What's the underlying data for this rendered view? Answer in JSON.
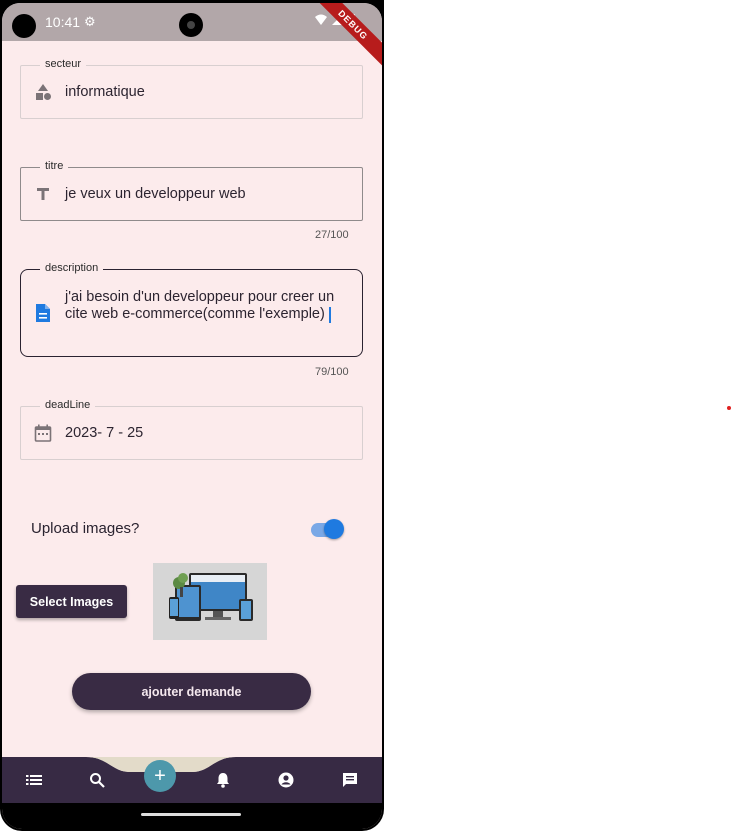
{
  "status_bar": {
    "time": "10:41",
    "debug_label": "DEBUG"
  },
  "form": {
    "secteur": {
      "label": "secteur",
      "value": "informatique",
      "icon": "category-icon"
    },
    "titre": {
      "label": "titre",
      "value": "je veux un developpeur web",
      "counter": "27/100",
      "icon": "title-icon"
    },
    "description": {
      "label": "description",
      "value_line1": "j'ai besoin d'un developpeur pour creer un",
      "value_line2": "cite web e-commerce(comme l'exemple)",
      "counter": "79/100",
      "icon": "document-icon"
    },
    "deadline": {
      "label": "deadLine",
      "value": "2023- 7 - 25",
      "icon": "calendar-icon"
    },
    "upload": {
      "label": "Upload images?",
      "enabled": true
    },
    "select_images_label": "Select Images",
    "submit_label": "ajouter demande"
  },
  "bottom_nav": {
    "items": [
      "list-icon",
      "search-icon",
      "add-icon",
      "notifications-icon",
      "account-icon",
      "chat-icon"
    ],
    "fab_symbol": "+"
  },
  "colors": {
    "background": "#fcebec",
    "primary": "#392b44",
    "accent": "#1f7ae0",
    "fab": "#4d98ab"
  }
}
